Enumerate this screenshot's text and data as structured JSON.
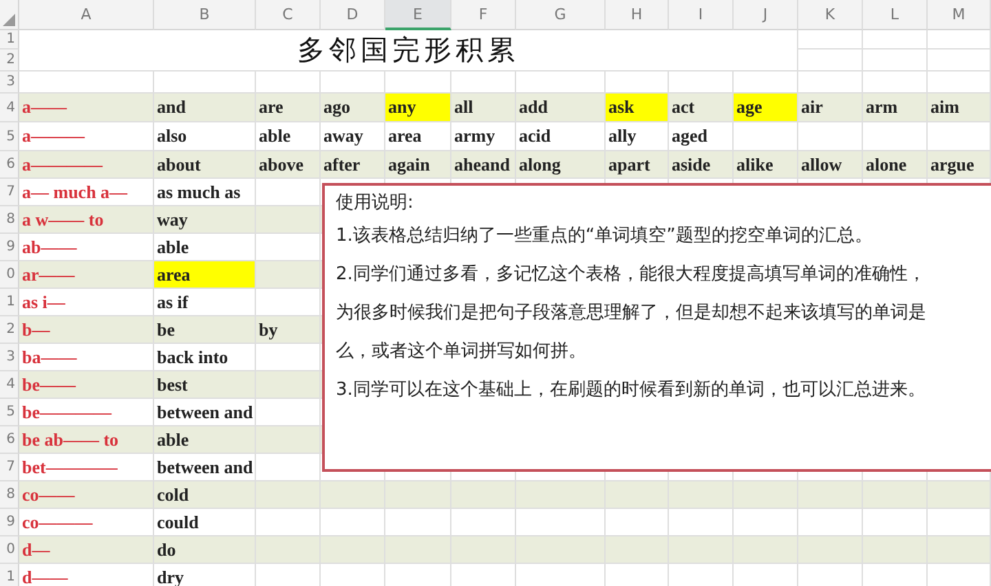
{
  "columns": [
    {
      "label": "A",
      "selected": false
    },
    {
      "label": "B",
      "selected": false
    },
    {
      "label": "C",
      "selected": false
    },
    {
      "label": "D",
      "selected": false
    },
    {
      "label": "E",
      "selected": true
    },
    {
      "label": "F",
      "selected": false
    },
    {
      "label": "G",
      "selected": false
    },
    {
      "label": "H",
      "selected": false
    },
    {
      "label": "I",
      "selected": false
    },
    {
      "label": "J",
      "selected": false
    },
    {
      "label": "K",
      "selected": false
    },
    {
      "label": "L",
      "selected": false
    },
    {
      "label": "M",
      "selected": false
    }
  ],
  "title": "多邻国完形积累",
  "rows": [
    {
      "number": "1"
    },
    {
      "number": "2"
    },
    {
      "number": "3"
    },
    {
      "number": "4",
      "cue": "a——",
      "cells": [
        {
          "text": "and",
          "highlighted": false
        },
        {
          "text": "are",
          "highlighted": false
        },
        {
          "text": "ago",
          "highlighted": false
        },
        {
          "text": "any",
          "highlighted": true
        },
        {
          "text": "all",
          "highlighted": false
        },
        {
          "text": "add",
          "highlighted": false
        },
        {
          "text": "ask",
          "highlighted": true
        },
        {
          "text": "act",
          "highlighted": false
        },
        {
          "text": "age",
          "highlighted": true
        },
        {
          "text": "air",
          "highlighted": false
        },
        {
          "text": "arm",
          "highlighted": false
        },
        {
          "text": "aim",
          "highlighted": false
        }
      ]
    },
    {
      "number": "5",
      "cue": "a———",
      "cells": [
        {
          "text": "also",
          "highlighted": false
        },
        {
          "text": "able",
          "highlighted": false
        },
        {
          "text": "away",
          "highlighted": false
        },
        {
          "text": "area",
          "highlighted": false
        },
        {
          "text": "army",
          "highlighted": false
        },
        {
          "text": "acid",
          "highlighted": false
        },
        {
          "text": "ally",
          "highlighted": false
        },
        {
          "text": "aged",
          "highlighted": false
        }
      ]
    },
    {
      "number": "6",
      "cue": "a————",
      "cells": [
        {
          "text": "about",
          "highlighted": false
        },
        {
          "text": "above",
          "highlighted": false
        },
        {
          "text": "after",
          "highlighted": false
        },
        {
          "text": "again",
          "highlighted": false
        },
        {
          "text": "aheand",
          "highlighted": false
        },
        {
          "text": "along",
          "highlighted": false
        },
        {
          "text": "apart",
          "highlighted": false
        },
        {
          "text": "aside",
          "highlighted": false
        },
        {
          "text": "alike",
          "highlighted": false
        },
        {
          "text": "allow",
          "highlighted": false
        },
        {
          "text": "alone",
          "highlighted": false
        },
        {
          "text": "argue",
          "highlighted": false
        }
      ]
    },
    {
      "number": "7",
      "cue": "a— much a—",
      "cells": [
        {
          "text": "as much as",
          "highlighted": false
        }
      ]
    },
    {
      "number": "8",
      "cue": "a w—— to",
      "cells": [
        {
          "text": "way",
          "highlighted": false
        }
      ]
    },
    {
      "number": "9",
      "cue": "ab——",
      "cells": [
        {
          "text": "able",
          "highlighted": false
        }
      ]
    },
    {
      "number": "0",
      "cue": "ar——",
      "cells": [
        {
          "text": "area",
          "highlighted": true
        }
      ]
    },
    {
      "number": "1",
      "cue": "as i—",
      "cells": [
        {
          "text": "as if",
          "highlighted": false
        }
      ]
    },
    {
      "number": "2",
      "cue": "b—",
      "cells": [
        {
          "text": "be",
          "highlighted": false
        },
        {
          "text": "by",
          "highlighted": false
        }
      ]
    },
    {
      "number": "3",
      "cue": "ba——",
      "cells": [
        {
          "text": "back into",
          "highlighted": false
        }
      ]
    },
    {
      "number": "4",
      "cue": "be——",
      "cells": [
        {
          "text": "best",
          "highlighted": false
        }
      ]
    },
    {
      "number": "5",
      "cue": "be————",
      "cells": [
        {
          "text": "between and",
          "highlighted": false
        }
      ]
    },
    {
      "number": "6",
      "cue": "be ab—— to",
      "cells": [
        {
          "text": "able",
          "highlighted": false
        }
      ]
    },
    {
      "number": "7",
      "cue": "bet————",
      "cells": [
        {
          "text": "between and",
          "highlighted": false
        }
      ]
    },
    {
      "number": "8",
      "cue": "co——",
      "cells": [
        {
          "text": "cold",
          "highlighted": false
        }
      ]
    },
    {
      "number": "9",
      "cue": "co———",
      "cells": [
        {
          "text": "could",
          "highlighted": false
        }
      ]
    },
    {
      "number": "0",
      "cue": "d—",
      "cells": [
        {
          "text": "do",
          "highlighted": false
        }
      ]
    },
    {
      "number": "1",
      "cue": "d——",
      "cells": [
        {
          "text": "dry",
          "highlighted": false
        }
      ]
    }
  ],
  "note": {
    "heading": "使用说明:",
    "lines": [
      "1.该表格总结归纳了一些重点的“单词填空”题型的挖空单词的汇总。",
      "2.同学们通过多看，多记忆这个表格，能很大程度提高填写单词的准确性，",
      "为很多时候我们是把句子段落意思理解了，但是却想不起来该填写的单词是",
      "么，或者这个单词拼写如何拼。",
      "3.同学可以在这个基础上，在刷题的时候看到新的单词，也可以汇总进来。"
    ]
  }
}
